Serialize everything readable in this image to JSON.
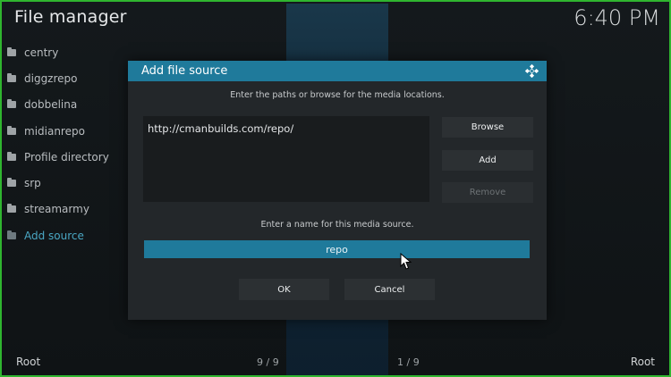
{
  "header": {
    "title": "File manager",
    "clock": "6:40 PM"
  },
  "sidebar": {
    "items": [
      {
        "label": "centry",
        "icon": "folder-icon"
      },
      {
        "label": "diggzrepo",
        "icon": "folder-icon"
      },
      {
        "label": "dobbelina",
        "icon": "folder-icon"
      },
      {
        "label": "midianrepo",
        "icon": "folder-icon"
      },
      {
        "label": "Profile directory",
        "icon": "folder-icon"
      },
      {
        "label": "srp",
        "icon": "folder-icon"
      },
      {
        "label": "streamarmy",
        "icon": "folder-icon"
      },
      {
        "label": "Add source",
        "icon": "folder-icon",
        "active": true
      }
    ]
  },
  "dialog": {
    "title": "Add file source",
    "instructions": "Enter the paths or browse for the media locations.",
    "path": "http://cmanbuilds.com/repo/",
    "browse_label": "Browse",
    "add_label": "Add",
    "remove_label": "Remove",
    "name_label": "Enter a name for this media source.",
    "name_value": "repo",
    "ok_label": "OK",
    "cancel_label": "Cancel"
  },
  "footer": {
    "left_root": "Root",
    "left_count": "9 / 9",
    "right_count": "1 / 9",
    "right_root": "Root"
  },
  "colors": {
    "accent": "#1f7a9b",
    "active_item": "#4aa7c4",
    "border": "#2fb52f"
  }
}
